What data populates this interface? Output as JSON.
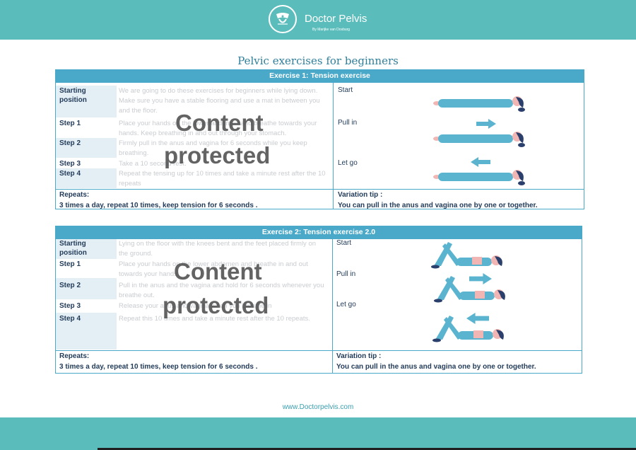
{
  "brand": {
    "name": "Doctor Pelvis",
    "sub": "By Marijke van Dosburg"
  },
  "title": "Pelvic exercises for beginners",
  "watermark": {
    "line1": "Content",
    "line2": "protected"
  },
  "exercise1": {
    "header": "Exercise 1: Tension exercise",
    "steps": [
      {
        "label": "Starting position",
        "text": "We are going to do these exercises for beginners while lying down. Make sure you have a stable flooring and use a mat in between you and the floor."
      },
      {
        "label": "Step 1",
        "text": "Place your hands on the lower abdomen and breathe towards your hands. Keep breathing in and out through your stomach."
      },
      {
        "label": "Step 2",
        "text": "Firmly pull in the anus and vagina for 6 seconds while you keep breathing."
      },
      {
        "label": "Step 3",
        "text": "Take a 10 second rest."
      },
      {
        "label": "Step 4",
        "text": "Repeat the tensing up for 10 times and take a minute rest after the 10 repeats"
      }
    ],
    "phases": [
      "Start",
      "Pull in",
      "Let go"
    ],
    "repeats_label": "Repeats:",
    "repeats_text": "3 times a day, repeat 10 times, keep tension for 6 seconds .",
    "tip_label": "Variation tip :",
    "tip_text": "You can pull in the anus and vagina one by one or together."
  },
  "exercise2": {
    "header": "Exercise  2:  Tension exercise 2.0",
    "steps": [
      {
        "label": "Starting position",
        "text": "Lying on the floor with the knees bent and the feet placed firmly on the ground."
      },
      {
        "label": "Step 1",
        "text": "Place your hands on the lower abdomen and breathe in and out towards your hands."
      },
      {
        "label": "Step 2",
        "text": "Pull in the anus and the vagina and hold for 6 seconds whenever you breathe out."
      },
      {
        "label": "Step 3",
        "text": "Release your anus and vagina when you breathe in"
      },
      {
        "label": "Step 4",
        "text": "Repeat this 10 times and take a minute rest after the 10 repeats."
      }
    ],
    "phases": [
      "Start",
      "Pull in",
      "Let go"
    ],
    "repeats_label": "Repeats:",
    "repeats_text": "3 times a day, repeat 10 times, keep tension for 6 seconds .",
    "tip_label": "Variation tip :",
    "tip_text": "You can pull in the anus and vagina one by one or together."
  },
  "website": "www.Doctorpelvis.com",
  "colors": {
    "brand_teal": "#5bbdbb",
    "table_blue": "#4aa9c9",
    "label_bg": "#e4eff5",
    "text_dark": "#233c5a",
    "figure_body": "#5ab4cf",
    "figure_skin": "#f1b6b3",
    "figure_hair": "#2a3f6b"
  }
}
